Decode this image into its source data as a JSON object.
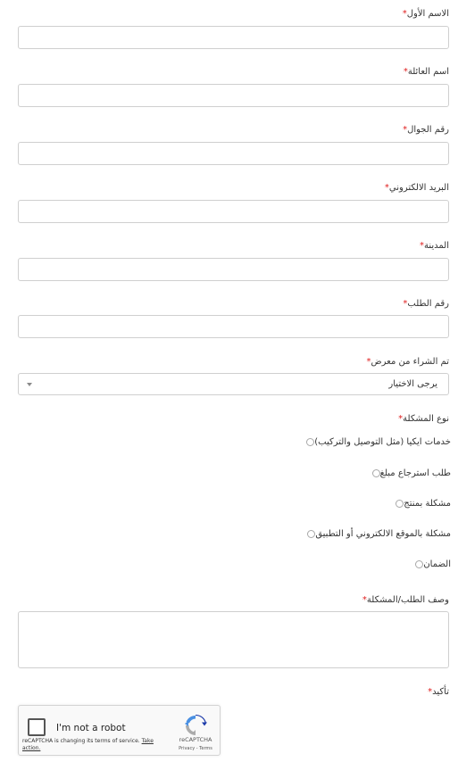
{
  "form": {
    "first_name": {
      "label": "الاسم الأول",
      "required_mark": "*",
      "value": ""
    },
    "family_name": {
      "label": "اسم العائلة",
      "required_mark": "*",
      "value": ""
    },
    "mobile": {
      "label": "رقم الجوال",
      "required_mark": "*",
      "value": ""
    },
    "email": {
      "label": "البريد الالكتروني",
      "required_mark": "*",
      "value": ""
    },
    "city": {
      "label": "المدينة",
      "required_mark": "*",
      "value": ""
    },
    "order_number": {
      "label": "رقم الطلب",
      "required_mark": "*",
      "value": ""
    },
    "store": {
      "label": "تم الشراء من معرض",
      "required_mark": "*",
      "selected": "يرجى الاختيار"
    },
    "problem_type": {
      "label": "نوع المشكلة",
      "required_mark": "*",
      "options": [
        "خدمات ايكيا (مثل التوصيل والتركيب)",
        "طلب استرجاع مبلغ",
        "مشكلة بمنتج",
        "مشكلة بالموقع الالكتروني أو التطبيق",
        "الضمان"
      ]
    },
    "description": {
      "label": "وصف الطلب/المشكلة",
      "required_mark": "*",
      "value": ""
    },
    "confirm": {
      "label": "تأكيد",
      "required_mark": "*"
    }
  },
  "recaptcha": {
    "checkbox_label": "I'm not a robot",
    "brand": "reCAPTCHA",
    "links": "Privacy - Terms",
    "notice_text": "reCAPTCHA is changing its terms of service.",
    "notice_link": "Take action."
  },
  "colors": {
    "required": "#e02020",
    "border": "#cfcfcf",
    "recaptcha_blue": "#1c3aa9",
    "recaptcha_light_blue": "#4a90e2",
    "recaptcha_gray": "#ababab"
  }
}
